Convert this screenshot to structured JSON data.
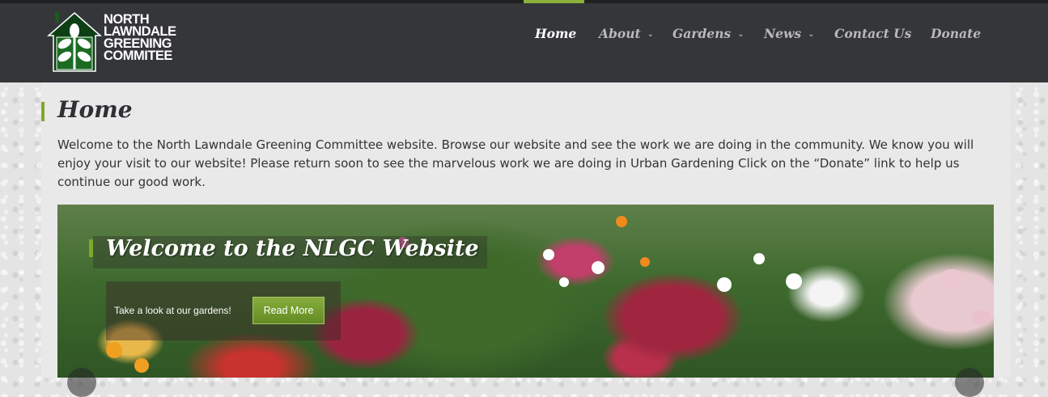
{
  "brand": {
    "logo_lines": [
      "NORTH",
      "LAWNDALE",
      "GREENING",
      "COMMITEE"
    ],
    "colors": {
      "header": "#35363a",
      "accent": "#7ea82b",
      "nav_inactive": "#b9b9b9"
    }
  },
  "nav": {
    "items": [
      {
        "label": "Home",
        "active": true,
        "has_dropdown": false
      },
      {
        "label": "About",
        "active": false,
        "has_dropdown": true
      },
      {
        "label": "Gardens",
        "active": false,
        "has_dropdown": true
      },
      {
        "label": "News",
        "active": false,
        "has_dropdown": true
      },
      {
        "label": "Contact Us",
        "active": false,
        "has_dropdown": false
      },
      {
        "label": "Donate",
        "active": false,
        "has_dropdown": false
      }
    ]
  },
  "page": {
    "title": "Home",
    "intro": "Welcome to the North Lawndale Greening Committee website. Browse our website and see the work we are doing in the community. We know you will enjoy your visit to our website! Please return soon to see the marvelous work we are doing in Urban Gardening  Click on the “Donate” link to help us continue our good work."
  },
  "slider": {
    "title": "Welcome to the NLGC Website",
    "caption": "Take a look at our gardens!",
    "button_label": "Read More",
    "icons": {
      "prev": "chevron-left-icon",
      "next": "chevron-right-icon"
    }
  }
}
